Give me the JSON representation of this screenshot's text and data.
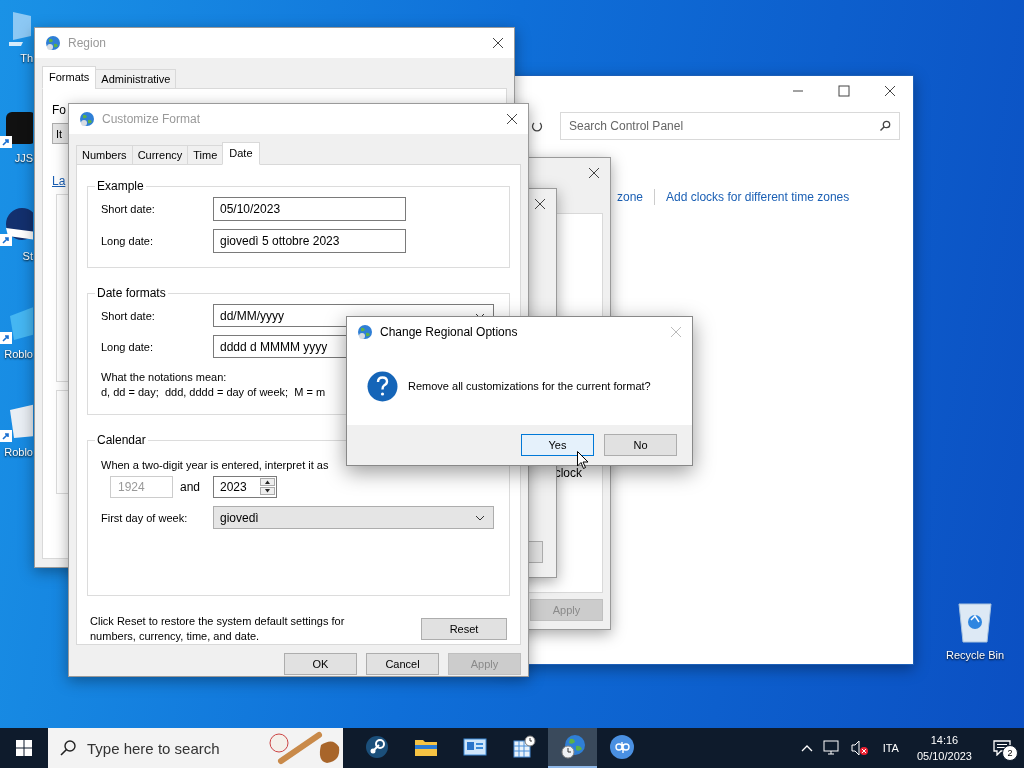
{
  "desktop": {
    "icons": [
      {
        "label": "Th",
        "kind": "monitor"
      },
      {
        "label": "JJS",
        "kind": "dark"
      },
      {
        "label": "St",
        "kind": "round"
      },
      {
        "label": "Roblo",
        "kind": "blue"
      },
      {
        "label": "Roblo",
        "kind": "white"
      }
    ],
    "recycle_bin": {
      "label": "Recycle Bin"
    }
  },
  "control_panel": {
    "search": {
      "placeholder": "Search Control Panel"
    },
    "links": [
      "zone",
      "Add clocks for different time zones"
    ]
  },
  "date_time_dialog": {
    "text": "clock",
    "buttons": [
      {
        "label": "Apply",
        "disabled": true
      }
    ]
  },
  "region": {
    "title": "Region",
    "tabs": [
      {
        "label": "Formats",
        "selected": true
      },
      {
        "label": "Administrative",
        "selected": false
      }
    ],
    "format_label": "Fo",
    "format_value": "It",
    "link": "La"
  },
  "customize_format": {
    "title": "Customize Format",
    "tabs": [
      {
        "label": "Numbers",
        "selected": false
      },
      {
        "label": "Currency",
        "selected": false
      },
      {
        "label": "Time",
        "selected": false
      },
      {
        "label": "Date",
        "selected": true
      }
    ],
    "example": {
      "title": "Example",
      "rows": [
        {
          "label": "Short date:",
          "value": "05/10/2023"
        },
        {
          "label": "Long date:",
          "value": "giovedì 5 ottobre 2023"
        }
      ]
    },
    "date_formats": {
      "title": "Date formats",
      "rows": [
        {
          "label": "Short date:",
          "value": "dd/MM/yyyy"
        },
        {
          "label": "Long date:",
          "value": "dddd d MMMM yyyy"
        }
      ],
      "notes_title": "What the notations mean:",
      "notes": "d, dd = day;  ddd, dddd = day of week;  M = m"
    },
    "calendar": {
      "title": "Calendar",
      "text": "When a two-digit year is entered, interpret it as",
      "from_year": {
        "value": "1924",
        "disabled": true
      },
      "and": "and",
      "to_year": "2023",
      "first_day_label": "First day of week:",
      "first_day_value": "giovedì"
    },
    "reset_text": "Click Reset to restore the system default settings for numbers, currency, time, and date.",
    "reset_button": "Reset",
    "buttons": [
      {
        "label": "OK",
        "disabled": false
      },
      {
        "label": "Cancel",
        "disabled": false
      },
      {
        "label": "Apply",
        "disabled": true
      }
    ]
  },
  "message_box": {
    "title": "Change Regional Options",
    "text": "Remove all customizations for the current format?",
    "buttons": [
      {
        "label": "Yes",
        "selected": true
      },
      {
        "label": "No",
        "selected": false
      }
    ]
  },
  "taskbar": {
    "search_placeholder": "Type here to search",
    "apps": [
      {
        "kind": "steam",
        "active": false
      },
      {
        "kind": "folder",
        "active": false
      },
      {
        "kind": "control-panel",
        "active": false
      },
      {
        "kind": "calendar",
        "active": false
      },
      {
        "kind": "region",
        "active": true
      },
      {
        "kind": "qbittorrent",
        "active": false
      }
    ],
    "language": "ITA",
    "time": "14:16",
    "date": "05/10/2023",
    "notification_count": "2"
  }
}
